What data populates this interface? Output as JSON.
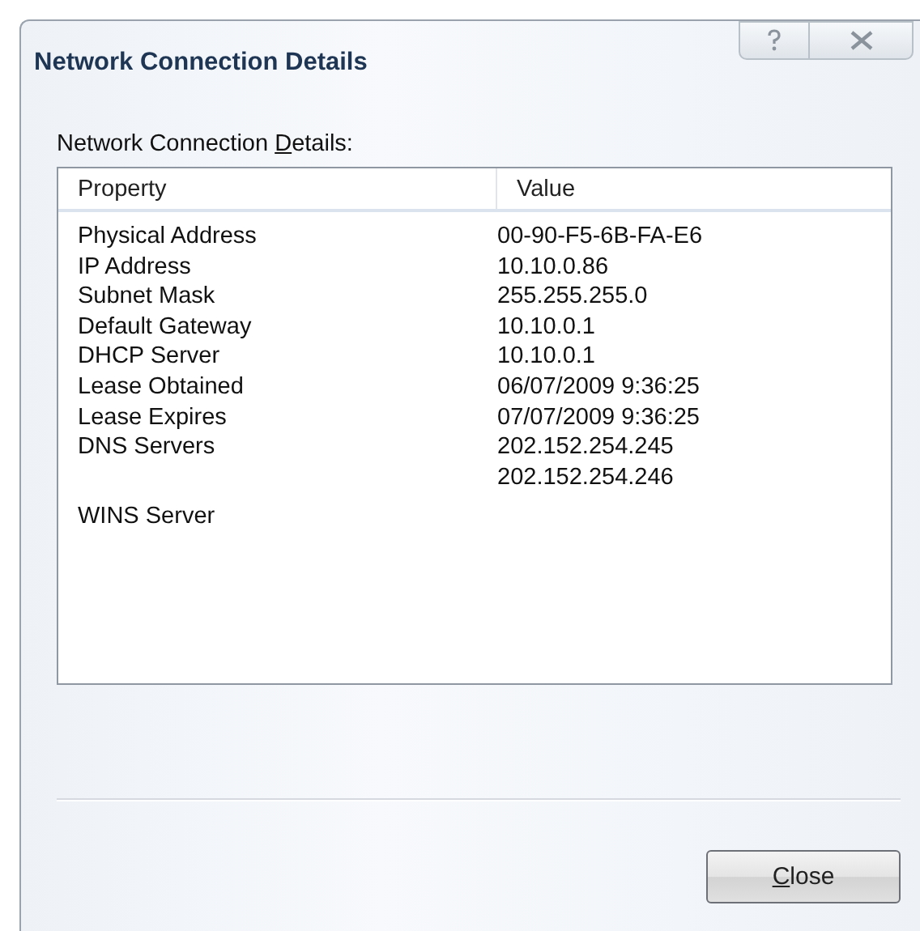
{
  "window": {
    "title": "Network Connection Details"
  },
  "title_buttons": [
    {
      "kind": "help"
    },
    {
      "kind": "close"
    }
  ],
  "list_label": {
    "before": "Network Connection ",
    "access_key": "D",
    "after": "etails:"
  },
  "table": {
    "columns": [
      "Property",
      "Value"
    ],
    "rows": [
      {
        "property": "Physical Address",
        "values": [
          "00-90-F5-6B-FA-E6"
        ]
      },
      {
        "property": "IP Address",
        "values": [
          "10.10.0.86"
        ]
      },
      {
        "property": "Subnet Mask",
        "values": [
          "255.255.255.0"
        ]
      },
      {
        "property": "Default Gateway",
        "values": [
          "10.10.0.1"
        ]
      },
      {
        "property": "DHCP Server",
        "values": [
          "10.10.0.1"
        ]
      },
      {
        "property": "Lease Obtained",
        "values": [
          "06/07/2009 9:36:25"
        ]
      },
      {
        "property": "Lease Expires",
        "values": [
          "07/07/2009 9:36:25"
        ]
      },
      {
        "property": "DNS Servers",
        "values": [
          "202.152.254.245",
          "202.152.254.246"
        ]
      },
      {
        "property": "WINS Server"
      }
    ]
  },
  "buttons": [
    {
      "access_key": "C",
      "after": "lose"
    }
  ]
}
